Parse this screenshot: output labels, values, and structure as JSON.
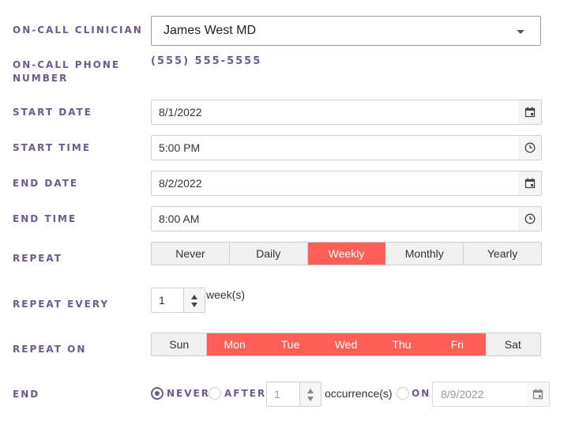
{
  "labels": {
    "clinician": "ON-CALL CLINICIAN",
    "phone_line1": "ON-CALL PHONE",
    "phone_line2": "NUMBER",
    "start_date": "START DATE",
    "start_time": "START TIME",
    "end_date": "END DATE",
    "end_time": "END TIME",
    "repeat": "REPEAT",
    "repeat_every": "REPEAT EVERY",
    "repeat_on": "REPEAT ON",
    "end": "END"
  },
  "clinician": {
    "value": "James West MD"
  },
  "phone": {
    "value": "(555) 555-5555"
  },
  "start_date": {
    "value": "8/1/2022",
    "icon": "calendar-icon"
  },
  "start_time": {
    "value": "5:00 PM",
    "icon": "clock-icon"
  },
  "end_date": {
    "value": "8/2/2022",
    "icon": "calendar-icon"
  },
  "end_time": {
    "value": "8:00 AM",
    "icon": "clock-icon"
  },
  "repeat": {
    "options": [
      "Never",
      "Daily",
      "Weekly",
      "Monthly",
      "Yearly"
    ],
    "selected": "Weekly"
  },
  "repeat_every": {
    "value": "1",
    "unit": "week(s)"
  },
  "repeat_on": {
    "days": [
      "Sun",
      "Mon",
      "Tue",
      "Wed",
      "Thu",
      "Fri",
      "Sat"
    ],
    "selected": [
      "Mon",
      "Tue",
      "Wed",
      "Thu",
      "Fri"
    ]
  },
  "end": {
    "never_label": "NEVER",
    "after_label": "AFTER",
    "after_count": "1",
    "occurrences_label": "occurrence(s)",
    "on_label": "ON",
    "on_date": "8/9/2022",
    "selected": "never"
  },
  "colors": {
    "accent": "#ff5f57",
    "label": "#6e5a8e"
  }
}
